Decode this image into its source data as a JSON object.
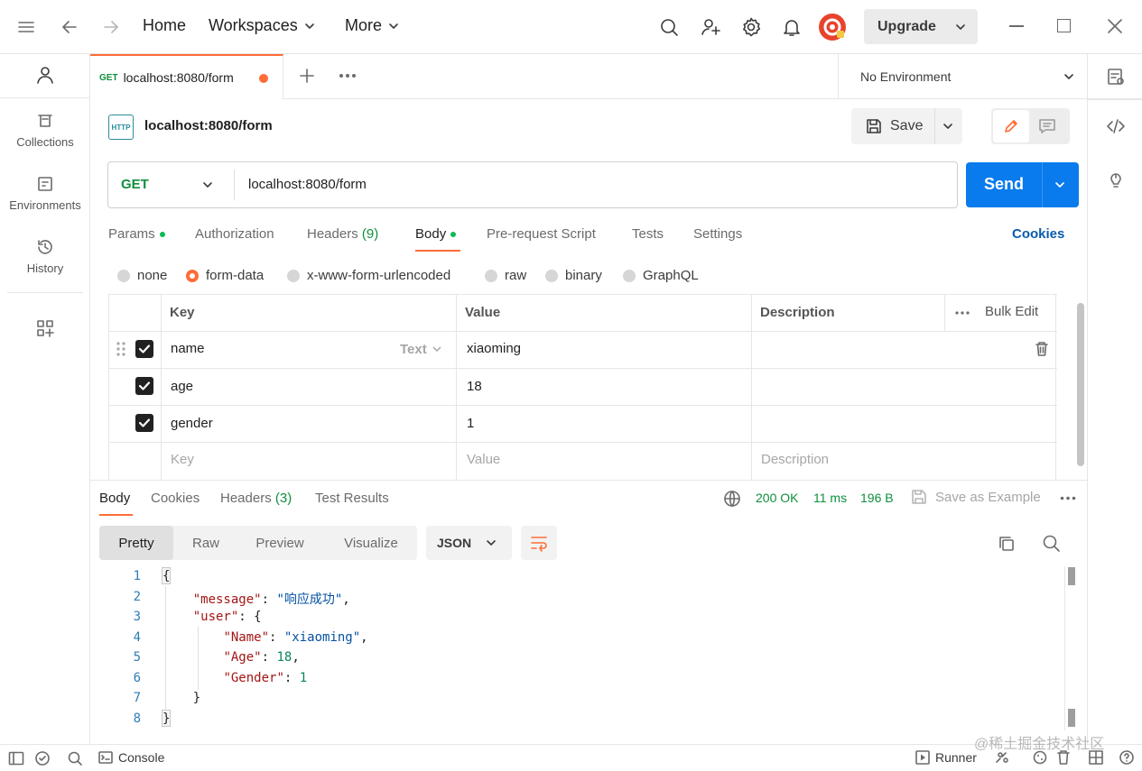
{
  "titlebar": {
    "home": "Home",
    "workspaces": "Workspaces",
    "more": "More",
    "upgrade": "Upgrade"
  },
  "sidebar": {
    "items": [
      {
        "label": "Collections"
      },
      {
        "label": "Environments"
      },
      {
        "label": "History"
      }
    ]
  },
  "tabs": {
    "active": {
      "method": "GET",
      "title": "localhost:8080/form"
    }
  },
  "environment": {
    "selected": "No Environment"
  },
  "request": {
    "name": "localhost:8080/form",
    "http_badge": "HTTP",
    "save_label": "Save",
    "method": "GET",
    "url": "localhost:8080/form",
    "send_label": "Send",
    "tabs": [
      "Params",
      "Authorization",
      "Headers",
      "(9)",
      "Body",
      "Pre-request Script",
      "Tests",
      "Settings"
    ],
    "cookies": "Cookies",
    "body_types": [
      "none",
      "form-data",
      "x-www-form-urlencoded",
      "raw",
      "binary",
      "GraphQL"
    ],
    "selected_body_type": "form-data"
  },
  "params_table": {
    "headers": {
      "key": "Key",
      "value": "Value",
      "description": "Description",
      "bulk_edit": "Bulk Edit"
    },
    "rows": [
      {
        "key": "name",
        "type": "Text",
        "value": "xiaoming",
        "checked": true
      },
      {
        "key": "age",
        "value": "18",
        "checked": true
      },
      {
        "key": "gender",
        "value": "1",
        "checked": true
      }
    ],
    "placeholder": {
      "key": "Key",
      "value": "Value",
      "description": "Description"
    }
  },
  "response": {
    "tabs": [
      "Body",
      "Cookies",
      "Headers",
      "(3)",
      "Test Results"
    ],
    "status": "200 OK",
    "time": "11 ms",
    "size": "196 B",
    "save_example": "Save as Example",
    "view_modes": [
      "Pretty",
      "Raw",
      "Preview",
      "Visualize"
    ],
    "format": "JSON",
    "code_lines": [
      "1",
      "2",
      "3",
      "4",
      "5",
      "6",
      "7",
      "8"
    ],
    "code": {
      "open": "{",
      "message_key": "\"message\"",
      "message_val": "\"响应成功\"",
      "user_key": "\"user\"",
      "name_key": "\"Name\"",
      "name_val": "\"xiaoming\"",
      "age_key": "\"Age\"",
      "age_val": "18",
      "gender_key": "\"Gender\"",
      "gender_val": "1",
      "inner_close": "}",
      "close": "}"
    }
  },
  "statusbar": {
    "console": "Console",
    "runner": "Runner",
    "watermark": "@稀土掘金技术社区"
  },
  "colors": {
    "accent": "#ff6c37",
    "send": "#097bed",
    "success": "#0cbb52",
    "status_ok": "#0f8f3e",
    "link": "#0b5cad"
  }
}
